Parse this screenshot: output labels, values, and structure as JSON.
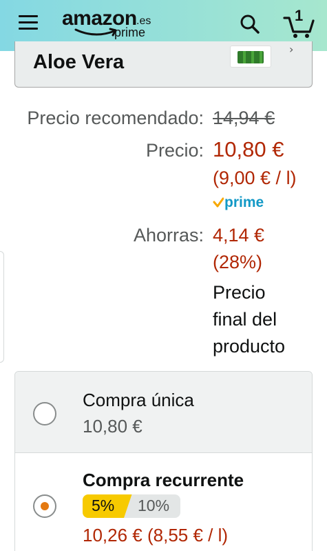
{
  "header": {
    "logo_word": "amazon",
    "logo_tld": ".es",
    "logo_sub": "prime",
    "cart_count": "1",
    "icons": [
      "menu-icon",
      "search-icon",
      "cart-icon"
    ],
    "colors": {
      "gradient_start": "#84d8e3",
      "gradient_end": "#a6e7ce"
    }
  },
  "product": {
    "title": "Aloe Vera"
  },
  "pricing": {
    "list_price_label": "Precio recomendado:",
    "list_price": "14,94 €",
    "price_label": "Precio:",
    "price": "10,80 €",
    "unit_price": "(9,00 € / l)",
    "prime_label": "prime",
    "savings_label": "Ahorras:",
    "savings": "4,14 €",
    "savings_percent": "(28%)",
    "final_note_line1": "Precio",
    "final_note_line2": "final del",
    "final_note_line3": "producto",
    "colors": {
      "price": "#b12704",
      "label": "#565959",
      "prime": "#1399c6"
    }
  },
  "purchase_options": {
    "one_time": {
      "title": "Compra única",
      "price": "10,80 €",
      "selected": false
    },
    "subscribe": {
      "title": "Compra recurrente",
      "discount_selected": "5%",
      "discount_other": "10%",
      "price": "10,26 € (8,55 € / l)",
      "selected": true
    },
    "colors": {
      "radio_dot": "#e47911",
      "pill_selected": "#f7ca00",
      "pill_other": "#e3e6e6"
    }
  }
}
